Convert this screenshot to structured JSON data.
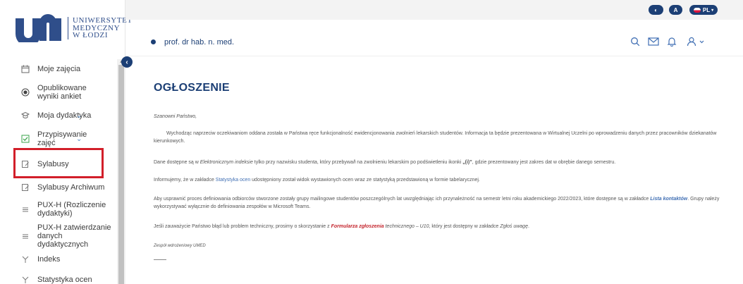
{
  "logo": {
    "line1": "UNIWERSYTET",
    "line2": "MEDYCZNY",
    "line3": "W ŁODZI"
  },
  "sidebar": {
    "items": [
      {
        "label": "Moje zajęcia",
        "icon": "calendar-icon"
      },
      {
        "label": "Opublikowane wyniki ankiet",
        "icon": "radio-icon"
      },
      {
        "label": "Moja dydaktyka",
        "icon": "teaching-icon",
        "expandable": true
      },
      {
        "label": "Przypisywanie zajęć",
        "icon": "checkbox-icon",
        "expandable": true
      },
      {
        "label": "Sylabusy",
        "icon": "edit-doc-icon"
      },
      {
        "label": "Sylabusy Archiwum",
        "icon": "edit-doc-icon"
      },
      {
        "label": "PUX-H (Rozliczenie dydaktyki)",
        "icon": "menu-lines-icon"
      },
      {
        "label": "PUX-H zatwierdzanie danych dydaktycznych",
        "icon": "menu-lines-icon"
      },
      {
        "label": "Indeks",
        "icon": "tree-icon"
      },
      {
        "label": "Statystyka ocen",
        "icon": "tree-icon"
      }
    ]
  },
  "topbar": {
    "contrast_label": "◐",
    "font_size_label": "A",
    "language_label": "PL",
    "user_name": "prof. dr hab. n. med."
  },
  "colors": {
    "brand": "#1c3f75",
    "accent": "#3f6eb3",
    "highlight": "#d21f2a",
    "active_item": "#3aa34a"
  },
  "main": {
    "title": "OGŁOSZENIE",
    "greeting": "Szanowni Państwo,",
    "p1": "Wychodząc naprzeciw oczekiwaniom oddana została w Państwa ręce funkcjonalność ewidencjonowania zwolnień lekarskich studentów. Informacja ta będzie prezentowana w Wirtualnej Uczelni po wprowadzeniu danych przez pracowników dziekanatów kierunkowych.",
    "p2_a": "Dane dostępne są w ",
    "p2_em": "Elektronicznym indeksie",
    "p2_b": " tylko przy nazwisku studenta, który przebywa/ł na zwolnieniu lekarskim po podświetleniu ikonki ",
    "p2_icon": "„(i)”",
    "p2_c": ", gdzie prezentowany jest zakres dat w obrębie danego semestru.",
    "p3_a": "Informujemy, że w zakładce ",
    "p3_link": "Statystyka ocen",
    "p3_b": " udostępniony został widok wystawionych ocen wraz ze statystyką przedstawioną w formie tabelarycznej.",
    "p4_a": "Aby usprawnić proces definiowania odbiorców stworzone zostały grupy mailingowe studentów poszczególnych lat uwzględniając ich przynależność na semestr letni roku akademickiego 2022/2023, które dostępne są w zakładce ",
    "p4_link": "Lista kontaktów",
    "p4_b": ". Grupy należy wykorzystywać wyłącznie do definiowania zespołów w Microsoft Teams.",
    "p5_a": "Jeśli zauważycie Państwo błąd lub problem techniczny, prosimy o skorzystanie z ",
    "p5_link": "Formularza zgłoszenia",
    "p5_b": " technicznego – U10",
    "p5_c": ", który jest dostępny w zakładce ",
    "p5_em": "Zgłoś uwagę",
    "p5_d": ".",
    "signature": "Zespół wdrożeniowy UMED"
  }
}
